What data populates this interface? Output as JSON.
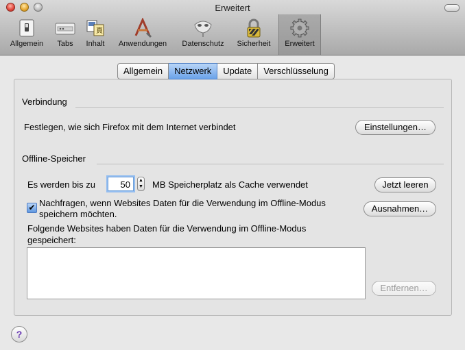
{
  "window": {
    "title": "Erweitert"
  },
  "toolbar": {
    "items": [
      {
        "label": "Allgemein",
        "icon": "switch-icon"
      },
      {
        "label": "Tabs",
        "icon": "tabs-icon"
      },
      {
        "label": "Inhalt",
        "icon": "content-icon"
      },
      {
        "label": "Anwendungen",
        "icon": "applications-icon"
      },
      {
        "label": "Datenschutz",
        "icon": "privacy-mask-icon"
      },
      {
        "label": "Sicherheit",
        "icon": "lock-icon"
      },
      {
        "label": "Erweitert",
        "icon": "gear-icon",
        "selected": true
      }
    ]
  },
  "tabs": [
    {
      "label": "Allgemein"
    },
    {
      "label": "Netzwerk",
      "active": true
    },
    {
      "label": "Update"
    },
    {
      "label": "Verschlüsselung"
    }
  ],
  "connection": {
    "heading": "Verbindung",
    "description": "Festlegen, wie sich Firefox mit dem Internet verbindet",
    "settings_button": "Einstellungen…"
  },
  "offline": {
    "heading": "Offline-Speicher",
    "cache_prefix": "Es werden bis zu",
    "cache_value": "50",
    "cache_suffix": "MB Speicherplatz als Cache verwendet",
    "clear_button": "Jetzt leeren",
    "ask_checkbox_checked": true,
    "ask_label_line1": "Nachfragen, wenn Websites Daten für die Verwendung im Offline-Modus",
    "ask_label_line2": "speichern möchten.",
    "exceptions_button": "Ausnahmen…",
    "sites_label_line1": "Folgende Websites haben Daten für die Verwendung im Offline-Modus",
    "sites_label_line2": "gespeichert:",
    "remove_button": "Entfernen…"
  },
  "help": {
    "label": "?"
  },
  "colors": {
    "accent": "#6aa2e9",
    "help_glyph": "#6c3db5"
  }
}
